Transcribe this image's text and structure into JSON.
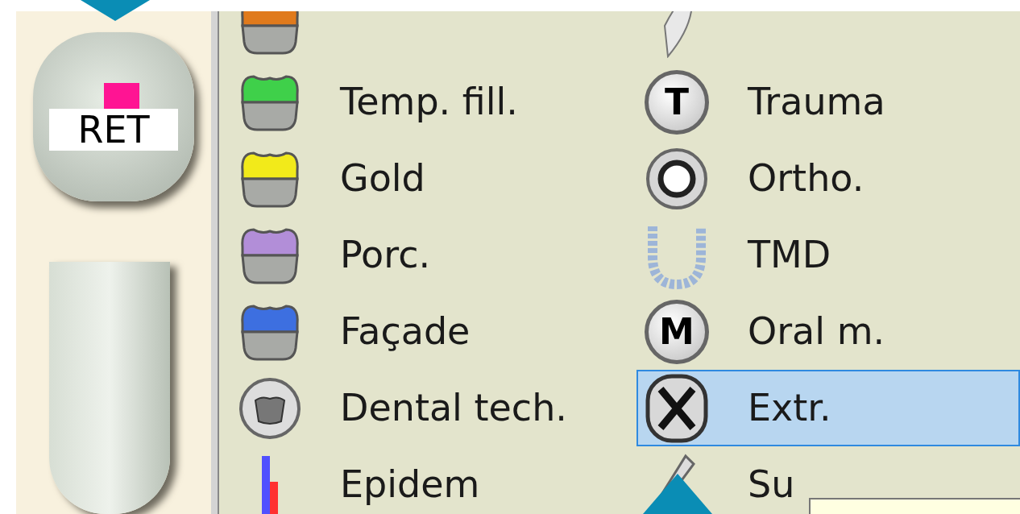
{
  "tooth_panel": {
    "crown_label": "RET"
  },
  "menu": {
    "rows": [
      [
        {
          "kind": "crown",
          "color": "#e07a1c"
        },
        {
          "kind": "leaf"
        }
      ],
      [
        {
          "kind": "crown",
          "color": "#3fd04a",
          "label": "Temp. fill.",
          "selected": false
        },
        {
          "kind": "letter",
          "glyph": "T",
          "label": "Trauma",
          "selected": false
        }
      ],
      [
        {
          "kind": "crown",
          "color": "#f2ea1a",
          "label": "Gold",
          "selected": false
        },
        {
          "kind": "ring",
          "label": "Ortho.",
          "selected": false
        }
      ],
      [
        {
          "kind": "crown",
          "color": "#b28ed8",
          "label": "Porc.",
          "selected": false
        },
        {
          "kind": "arch",
          "label": "TMD",
          "selected": false
        }
      ],
      [
        {
          "kind": "crown",
          "color": "#3d6fe0",
          "label": "Façade",
          "selected": false
        },
        {
          "kind": "letter",
          "glyph": "M",
          "label": "Oral m.",
          "selected": false
        }
      ],
      [
        {
          "kind": "tech",
          "label": "Dental tech.",
          "selected": false
        },
        {
          "kind": "cross",
          "label": "Extr.",
          "selected": true
        }
      ],
      [
        {
          "kind": "bars",
          "label": "Epidem",
          "selected": false
        },
        {
          "kind": "pen",
          "label": "Su",
          "selected": false
        }
      ]
    ]
  },
  "tooltip": {
    "visible": true
  }
}
